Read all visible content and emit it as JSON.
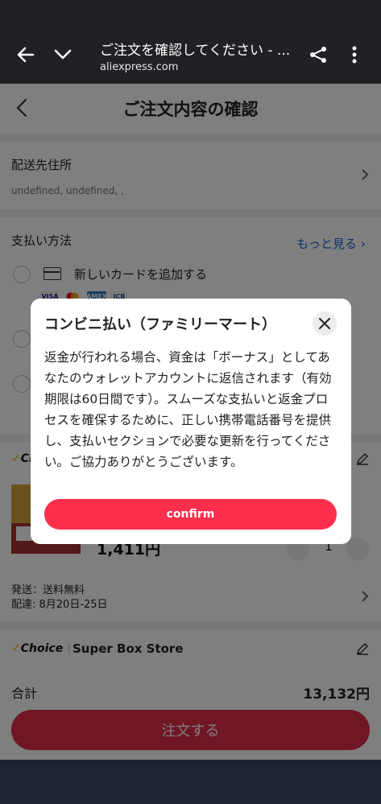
{
  "browser": {
    "title": "ご注文を確認してください - ...",
    "url": "aliexpress.com"
  },
  "page": {
    "title": "ご注文内容の確認",
    "shipping_address": {
      "label": "配送先住所",
      "value": "undefined, undefined, ,"
    },
    "payment": {
      "label": "支払い方法",
      "see_more": "もっと見る",
      "add_card": "新しいカードを追加する",
      "card_brands": [
        "VISA",
        "MC",
        "AMEX",
        "JCB"
      ]
    },
    "store1": {
      "choice_badge": "Ch",
      "price": "1,411円",
      "quantity": "1",
      "shipping": "発送：送料無料",
      "delivery": "配達: 8月20日-25日"
    },
    "store2": {
      "choice_badge": "Choice",
      "name": "Super Box Store"
    },
    "total_label": "合計",
    "total_value": "13,132円",
    "order_button": "注文する"
  },
  "modal": {
    "title": "コンビニ払い（ファミリーマート）",
    "body": "返金が行われる場合、資金は「ボーナス」としてあなたのウォレットアカウントに返信されます（有効期限は60日間です）。スムーズな支払いと返金プロセスを確保するために、正しい携帯電話番号を提供し、支払いセクションで必要な更新を行ってください。ご協力ありがとうございます。",
    "confirm": "confirm"
  },
  "colors": {
    "accent": "#fe2e4d",
    "link": "#1a63d8",
    "dark_bar": "#202124"
  }
}
